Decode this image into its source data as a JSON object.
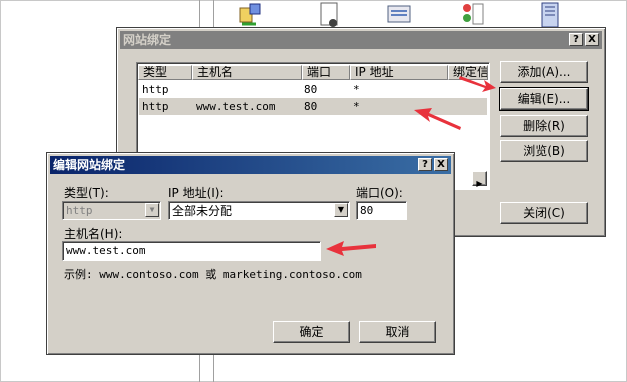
{
  "accent": {
    "title_active": "#0a246a",
    "title_inactive": "#808080",
    "arrow": "#e8323c"
  },
  "toolbar_icons": [
    "transfer-icon",
    "document-icon",
    "server-icon",
    "users-icon",
    "notebook-icon"
  ],
  "back_dialog": {
    "title": "网站绑定",
    "help_btn": "?",
    "close_btn": "X",
    "columns": [
      "类型",
      "主机名",
      "端口",
      "IP 地址",
      "绑定信"
    ],
    "rows": [
      {
        "type": "http",
        "host": "",
        "port": "80",
        "ip": "*"
      },
      {
        "type": "http",
        "host": "www.test.com",
        "port": "80",
        "ip": "*"
      }
    ],
    "buttons": {
      "add": "添加(A)...",
      "edit": "编辑(E)...",
      "remove": "删除(R)",
      "browse": "浏览(B)",
      "close": "关闭(C)"
    }
  },
  "edit_dialog": {
    "title": "编辑网站绑定",
    "help_btn": "?",
    "close_btn": "X",
    "type_label": "类型(T):",
    "type_value": "http",
    "ip_label": "IP 地址(I):",
    "ip_value": "全部未分配",
    "port_label": "端口(O):",
    "port_value": "80",
    "host_label": "主机名(H):",
    "host_value": "www.test.com",
    "example": "示例: www.contoso.com 或 marketing.contoso.com",
    "ok": "确定",
    "cancel": "取消"
  }
}
